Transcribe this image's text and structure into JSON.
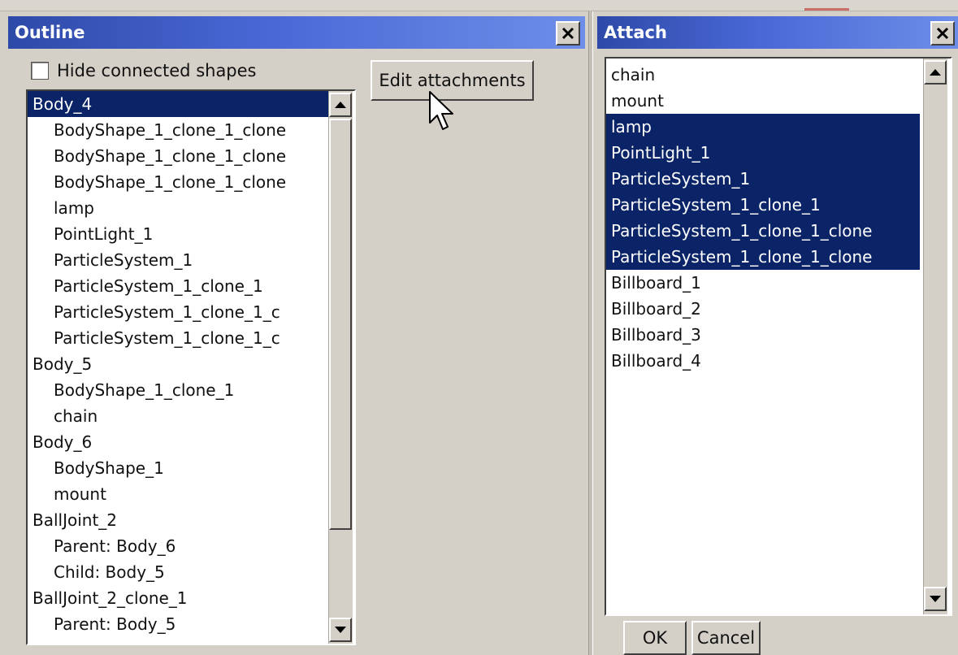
{
  "colors": {
    "title_gradient_start": "#2e4aa8",
    "title_gradient_end": "#6d8ee8",
    "selection": "#0a2467",
    "panel_bg": "#d4d0c8"
  },
  "outline": {
    "title": "Outline",
    "close_icon": "close-icon",
    "hide_connected_label": "Hide connected shapes",
    "hide_connected_checked": false,
    "edit_attachments_label": "Edit attachments",
    "items": [
      {
        "text": "Body_4",
        "indent": false,
        "selected": true
      },
      {
        "text": "BodyShape_1_clone_1_clone",
        "indent": true,
        "selected": false
      },
      {
        "text": "BodyShape_1_clone_1_clone",
        "indent": true,
        "selected": false
      },
      {
        "text": "BodyShape_1_clone_1_clone",
        "indent": true,
        "selected": false
      },
      {
        "text": "lamp",
        "indent": true,
        "selected": false
      },
      {
        "text": "PointLight_1",
        "indent": true,
        "selected": false
      },
      {
        "text": "ParticleSystem_1",
        "indent": true,
        "selected": false
      },
      {
        "text": "ParticleSystem_1_clone_1",
        "indent": true,
        "selected": false
      },
      {
        "text": "ParticleSystem_1_clone_1_c",
        "indent": true,
        "selected": false
      },
      {
        "text": "ParticleSystem_1_clone_1_c",
        "indent": true,
        "selected": false
      },
      {
        "text": "Body_5",
        "indent": false,
        "selected": false
      },
      {
        "text": "BodyShape_1_clone_1",
        "indent": true,
        "selected": false
      },
      {
        "text": "chain",
        "indent": true,
        "selected": false
      },
      {
        "text": "Body_6",
        "indent": false,
        "selected": false
      },
      {
        "text": "BodyShape_1",
        "indent": true,
        "selected": false
      },
      {
        "text": "mount",
        "indent": true,
        "selected": false
      },
      {
        "text": "BallJoint_2",
        "indent": false,
        "selected": false
      },
      {
        "text": "Parent: Body_6",
        "indent": true,
        "selected": false
      },
      {
        "text": "Child: Body_5",
        "indent": true,
        "selected": false
      },
      {
        "text": "BallJoint_2_clone_1",
        "indent": false,
        "selected": false
      },
      {
        "text": "Parent: Body_5",
        "indent": true,
        "selected": false
      }
    ]
  },
  "attach": {
    "title": "Attach",
    "close_icon": "close-icon",
    "items": [
      {
        "text": "chain",
        "selected": false
      },
      {
        "text": "mount",
        "selected": false
      },
      {
        "text": "lamp",
        "selected": true
      },
      {
        "text": "PointLight_1",
        "selected": true
      },
      {
        "text": "ParticleSystem_1",
        "selected": true
      },
      {
        "text": "ParticleSystem_1_clone_1",
        "selected": true
      },
      {
        "text": "ParticleSystem_1_clone_1_clone",
        "selected": true
      },
      {
        "text": "ParticleSystem_1_clone_1_clone",
        "selected": true
      },
      {
        "text": "Billboard_1",
        "selected": false
      },
      {
        "text": "Billboard_2",
        "selected": false
      },
      {
        "text": "Billboard_3",
        "selected": false
      },
      {
        "text": "Billboard_4",
        "selected": false
      }
    ],
    "ok_label": "OK",
    "cancel_label": "Cancel"
  }
}
